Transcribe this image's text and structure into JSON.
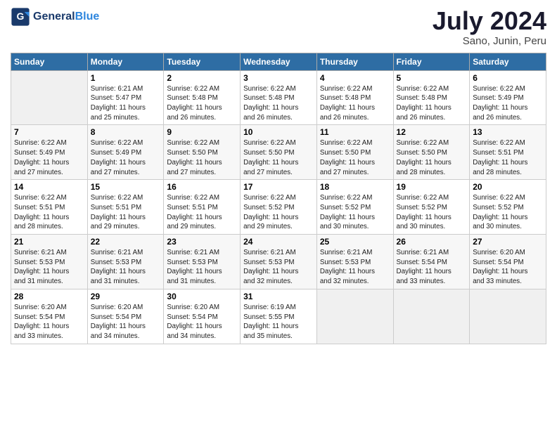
{
  "header": {
    "logo_general": "General",
    "logo_blue": "Blue",
    "title": "July 2024",
    "subtitle": "Sano, Junin, Peru"
  },
  "columns": [
    "Sunday",
    "Monday",
    "Tuesday",
    "Wednesday",
    "Thursday",
    "Friday",
    "Saturday"
  ],
  "weeks": [
    [
      {
        "day": "",
        "info": ""
      },
      {
        "day": "1",
        "info": "Sunrise: 6:21 AM\nSunset: 5:47 PM\nDaylight: 11 hours\nand 25 minutes."
      },
      {
        "day": "2",
        "info": "Sunrise: 6:22 AM\nSunset: 5:48 PM\nDaylight: 11 hours\nand 26 minutes."
      },
      {
        "day": "3",
        "info": "Sunrise: 6:22 AM\nSunset: 5:48 PM\nDaylight: 11 hours\nand 26 minutes."
      },
      {
        "day": "4",
        "info": "Sunrise: 6:22 AM\nSunset: 5:48 PM\nDaylight: 11 hours\nand 26 minutes."
      },
      {
        "day": "5",
        "info": "Sunrise: 6:22 AM\nSunset: 5:48 PM\nDaylight: 11 hours\nand 26 minutes."
      },
      {
        "day": "6",
        "info": "Sunrise: 6:22 AM\nSunset: 5:49 PM\nDaylight: 11 hours\nand 26 minutes."
      }
    ],
    [
      {
        "day": "7",
        "info": "Sunrise: 6:22 AM\nSunset: 5:49 PM\nDaylight: 11 hours\nand 27 minutes."
      },
      {
        "day": "8",
        "info": "Sunrise: 6:22 AM\nSunset: 5:49 PM\nDaylight: 11 hours\nand 27 minutes."
      },
      {
        "day": "9",
        "info": "Sunrise: 6:22 AM\nSunset: 5:50 PM\nDaylight: 11 hours\nand 27 minutes."
      },
      {
        "day": "10",
        "info": "Sunrise: 6:22 AM\nSunset: 5:50 PM\nDaylight: 11 hours\nand 27 minutes."
      },
      {
        "day": "11",
        "info": "Sunrise: 6:22 AM\nSunset: 5:50 PM\nDaylight: 11 hours\nand 27 minutes."
      },
      {
        "day": "12",
        "info": "Sunrise: 6:22 AM\nSunset: 5:50 PM\nDaylight: 11 hours\nand 28 minutes."
      },
      {
        "day": "13",
        "info": "Sunrise: 6:22 AM\nSunset: 5:51 PM\nDaylight: 11 hours\nand 28 minutes."
      }
    ],
    [
      {
        "day": "14",
        "info": "Sunrise: 6:22 AM\nSunset: 5:51 PM\nDaylight: 11 hours\nand 28 minutes."
      },
      {
        "day": "15",
        "info": "Sunrise: 6:22 AM\nSunset: 5:51 PM\nDaylight: 11 hours\nand 29 minutes."
      },
      {
        "day": "16",
        "info": "Sunrise: 6:22 AM\nSunset: 5:51 PM\nDaylight: 11 hours\nand 29 minutes."
      },
      {
        "day": "17",
        "info": "Sunrise: 6:22 AM\nSunset: 5:52 PM\nDaylight: 11 hours\nand 29 minutes."
      },
      {
        "day": "18",
        "info": "Sunrise: 6:22 AM\nSunset: 5:52 PM\nDaylight: 11 hours\nand 30 minutes."
      },
      {
        "day": "19",
        "info": "Sunrise: 6:22 AM\nSunset: 5:52 PM\nDaylight: 11 hours\nand 30 minutes."
      },
      {
        "day": "20",
        "info": "Sunrise: 6:22 AM\nSunset: 5:52 PM\nDaylight: 11 hours\nand 30 minutes."
      }
    ],
    [
      {
        "day": "21",
        "info": "Sunrise: 6:21 AM\nSunset: 5:53 PM\nDaylight: 11 hours\nand 31 minutes."
      },
      {
        "day": "22",
        "info": "Sunrise: 6:21 AM\nSunset: 5:53 PM\nDaylight: 11 hours\nand 31 minutes."
      },
      {
        "day": "23",
        "info": "Sunrise: 6:21 AM\nSunset: 5:53 PM\nDaylight: 11 hours\nand 31 minutes."
      },
      {
        "day": "24",
        "info": "Sunrise: 6:21 AM\nSunset: 5:53 PM\nDaylight: 11 hours\nand 32 minutes."
      },
      {
        "day": "25",
        "info": "Sunrise: 6:21 AM\nSunset: 5:53 PM\nDaylight: 11 hours\nand 32 minutes."
      },
      {
        "day": "26",
        "info": "Sunrise: 6:21 AM\nSunset: 5:54 PM\nDaylight: 11 hours\nand 33 minutes."
      },
      {
        "day": "27",
        "info": "Sunrise: 6:20 AM\nSunset: 5:54 PM\nDaylight: 11 hours\nand 33 minutes."
      }
    ],
    [
      {
        "day": "28",
        "info": "Sunrise: 6:20 AM\nSunset: 5:54 PM\nDaylight: 11 hours\nand 33 minutes."
      },
      {
        "day": "29",
        "info": "Sunrise: 6:20 AM\nSunset: 5:54 PM\nDaylight: 11 hours\nand 34 minutes."
      },
      {
        "day": "30",
        "info": "Sunrise: 6:20 AM\nSunset: 5:54 PM\nDaylight: 11 hours\nand 34 minutes."
      },
      {
        "day": "31",
        "info": "Sunrise: 6:19 AM\nSunset: 5:55 PM\nDaylight: 11 hours\nand 35 minutes."
      },
      {
        "day": "",
        "info": ""
      },
      {
        "day": "",
        "info": ""
      },
      {
        "day": "",
        "info": ""
      }
    ]
  ]
}
